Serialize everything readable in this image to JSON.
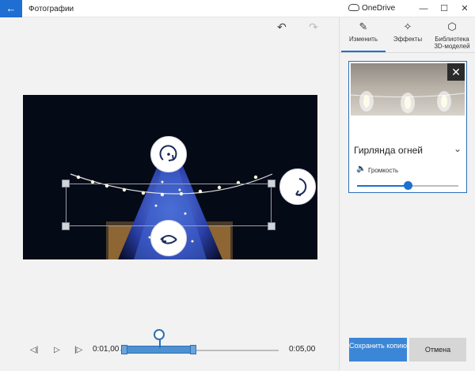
{
  "app": {
    "title": "Фотографии",
    "back_label": "←",
    "onedrive_label": "OneDrive",
    "window_controls": {
      "minimize": "—",
      "maximize": "☐",
      "close": "✕"
    }
  },
  "toolbar": {
    "undo_icon": "undo-icon",
    "redo_icon": "redo-icon"
  },
  "tabs": [
    {
      "label": "Изменить",
      "icon": "pencil-icon",
      "active": true
    },
    {
      "label": "Эффекты",
      "icon": "magic-wand-icon",
      "active": false
    },
    {
      "label": "Библиотека 3D-моделей",
      "icon": "cube-icon",
      "active": false
    }
  ],
  "effect_card": {
    "title": "Гирлянда огней",
    "volume_label": "Громкость",
    "volume_level": 0.5
  },
  "timeline": {
    "start_time": "0:01,00",
    "end_time": "0:05,00"
  },
  "buttons": {
    "save": "Сохранить копию",
    "cancel": "Отмена"
  },
  "colors": {
    "accent": "#1e6fd1",
    "save_bg": "#3b86d6",
    "cancel_bg": "#d6d6d6"
  }
}
